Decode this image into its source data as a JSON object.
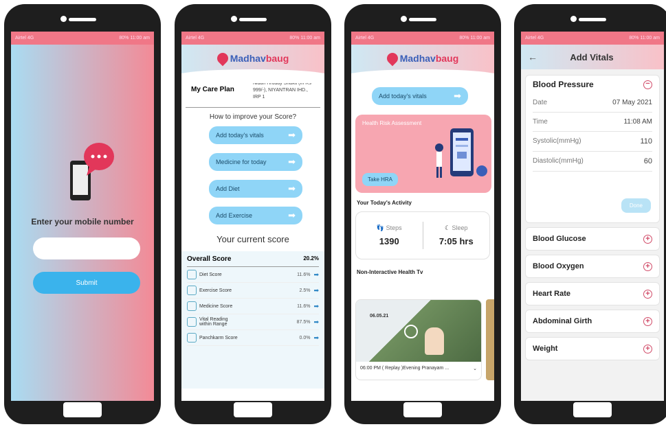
{
  "brand": {
    "name_a": "Madhav",
    "name_b": "baug"
  },
  "status": {
    "left": "Airtel 4G",
    "right": "80% 11:00 am"
  },
  "screen1": {
    "prompt": "Enter your mobile number",
    "input_placeholder": "",
    "submit": "Submit"
  },
  "screen2": {
    "care_plan_label": "My Care Plan",
    "care_plan_value": "Nidan Hruday Shakti (In Rs 999/-), NIYANTRAN IHD., IRP 1",
    "improve_title": "How to improve your Score?",
    "actions": [
      "Add today's vitals",
      "Medicine for today",
      "Add Diet",
      "Add Exercise"
    ],
    "current_score_title": "Your current score",
    "overall_label": "Overall Score",
    "overall_value": "20.2%",
    "scores": [
      {
        "name": "Diet Score",
        "value": "11.6%"
      },
      {
        "name": "Exercise Score",
        "value": "2.5%"
      },
      {
        "name": "Medicine Score",
        "value": "11.6%"
      },
      {
        "name": "Vital Reading within Range",
        "value": "87.5%"
      },
      {
        "name": "Panchkarm Score",
        "value": "0.0%"
      }
    ]
  },
  "screen3": {
    "vitals_button": "Add today's vitals",
    "hra_title": "Health Risk Assessment",
    "hra_button": "Take HRA",
    "activity_title": "Your Today's Activity",
    "steps_label": "Steps",
    "steps_value": "1390",
    "sleep_label": "Sleep",
    "sleep_value": "7:05 hrs",
    "tv_title": "Non-Interactive Health Tv",
    "tv_date": "06.05.21",
    "tv_caption": "06:00 PM ( Replay )Evening Pranayam ..."
  },
  "screen4": {
    "title": "Add Vitals",
    "bp_title": "Blood Pressure",
    "rows": [
      {
        "label": "Date",
        "value": "07 May 2021"
      },
      {
        "label": "Time",
        "value": "11:08 AM"
      },
      {
        "label": "Systolic(mmHg)",
        "value": "110"
      },
      {
        "label": "Diastolic(mmHg)",
        "value": "60"
      }
    ],
    "done": "Done",
    "sections": [
      "Blood Glucose",
      "Blood Oxygen",
      "Heart Rate",
      "Abdominal Girth",
      "Weight"
    ]
  },
  "colors": {
    "accent_pink": "#f07787",
    "pill_blue": "#8fd5f7",
    "brand_red": "#e2375a",
    "brand_blue": "#3a5fb8"
  }
}
